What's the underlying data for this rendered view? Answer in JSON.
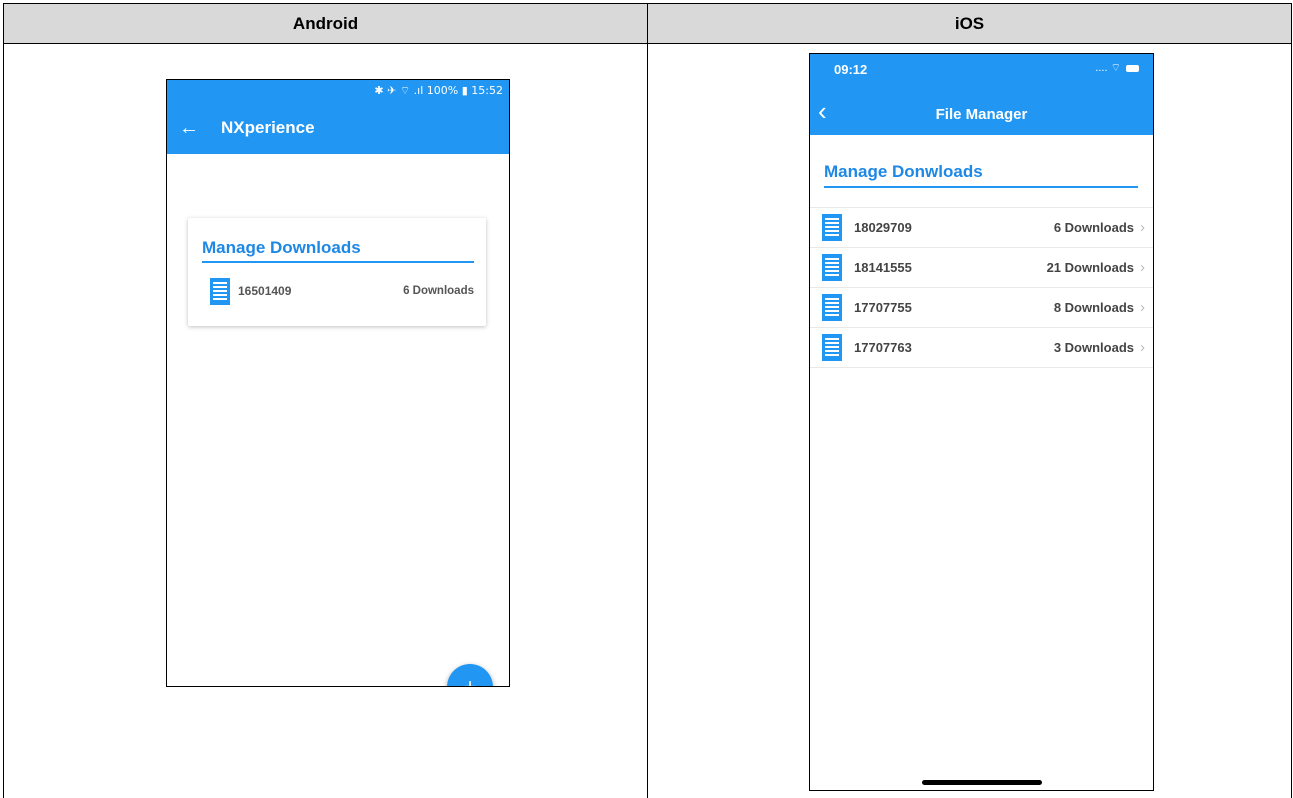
{
  "columns": [
    "Android",
    "iOS"
  ],
  "android": {
    "status_bar": "✱ ✈ ⌔ .ıl 100% ▮ 15:52",
    "back_icon": "←",
    "app_title": "NXperience",
    "card_heading": "Manage Downloads",
    "item": {
      "number": "16501409",
      "downloads": "6 Downloads"
    },
    "fab_label": "+",
    "accent_color": "#2196f3"
  },
  "ios": {
    "time": "09:12",
    "signal": "....",
    "wifi": "⌔",
    "back_icon": "‹",
    "nav_title": "File Manager",
    "section_heading": "Manage Donwloads",
    "items": [
      {
        "number": "18029709",
        "downloads": "6 Downloads"
      },
      {
        "number": "18141555",
        "downloads": "21 Downloads"
      },
      {
        "number": "17707755",
        "downloads": "8 Downloads"
      },
      {
        "number": "17707763",
        "downloads": "3 Downloads"
      }
    ],
    "chevron": "›",
    "accent_color": "#2196f3"
  }
}
